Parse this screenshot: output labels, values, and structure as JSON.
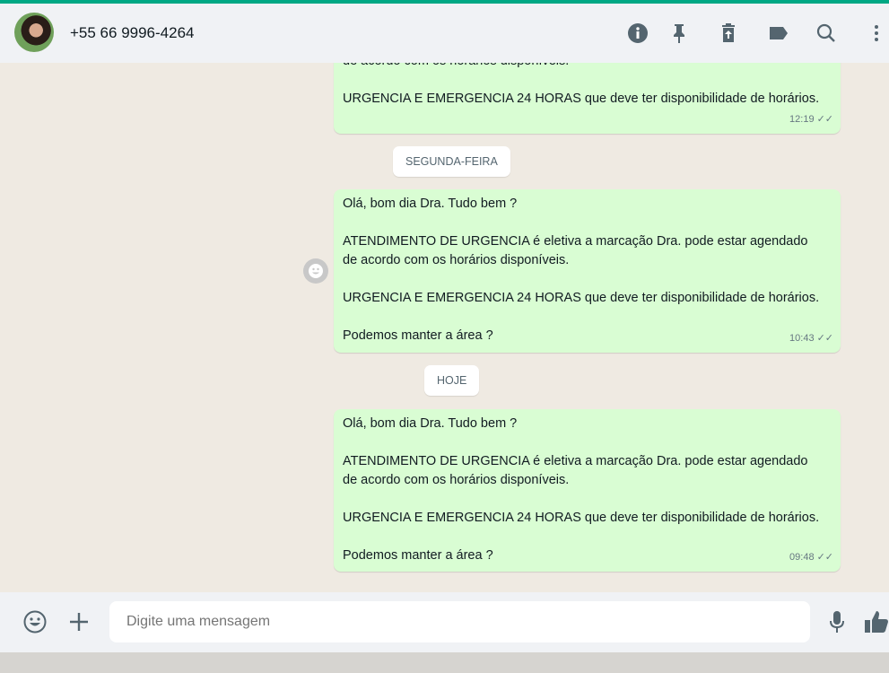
{
  "header": {
    "contact": "+55 66 9996-4264",
    "icons": [
      "info-icon",
      "pin-icon",
      "delete-icon",
      "label-icon",
      "search-icon",
      "menu-icon"
    ]
  },
  "messages": [
    {
      "lines": [
        "de acordo com os horários disponíveis.",
        "",
        "URGENCIA E EMERGENCIA 24 HORAS que deve ter disponibilidade de horários."
      ],
      "time": "12:19"
    },
    {
      "lines": [
        "Olá, bom dia Dra. Tudo bem ?",
        "",
        "ATENDIMENTO DE URGENCIA é eletiva a marcação Dra. pode estar agendado",
        "de acordo com os horários disponíveis.",
        "",
        "URGENCIA E EMERGENCIA 24 HORAS que deve ter disponibilidade de horários.",
        "",
        "Podemos manter a área ?"
      ],
      "time": "10:43"
    },
    {
      "lines": [
        "Olá, bom dia Dra. Tudo bem ?",
        "",
        "ATENDIMENTO DE URGENCIA é eletiva a marcação Dra. pode estar agendado",
        "de acordo com os horários disponíveis.",
        "",
        "URGENCIA E EMERGENCIA 24 HORAS que deve ter disponibilidade de horários.",
        "",
        "Podemos manter a área ?"
      ],
      "time": "09:48"
    }
  ],
  "dates": {
    "d1": "SEGUNDA-FEIRA",
    "d2": "HOJE"
  },
  "composer": {
    "placeholder": "Digite uma mensagem"
  },
  "colors": {
    "accent": "#00a884",
    "bubble": "#d9fdd3",
    "icon": "#54656f"
  }
}
